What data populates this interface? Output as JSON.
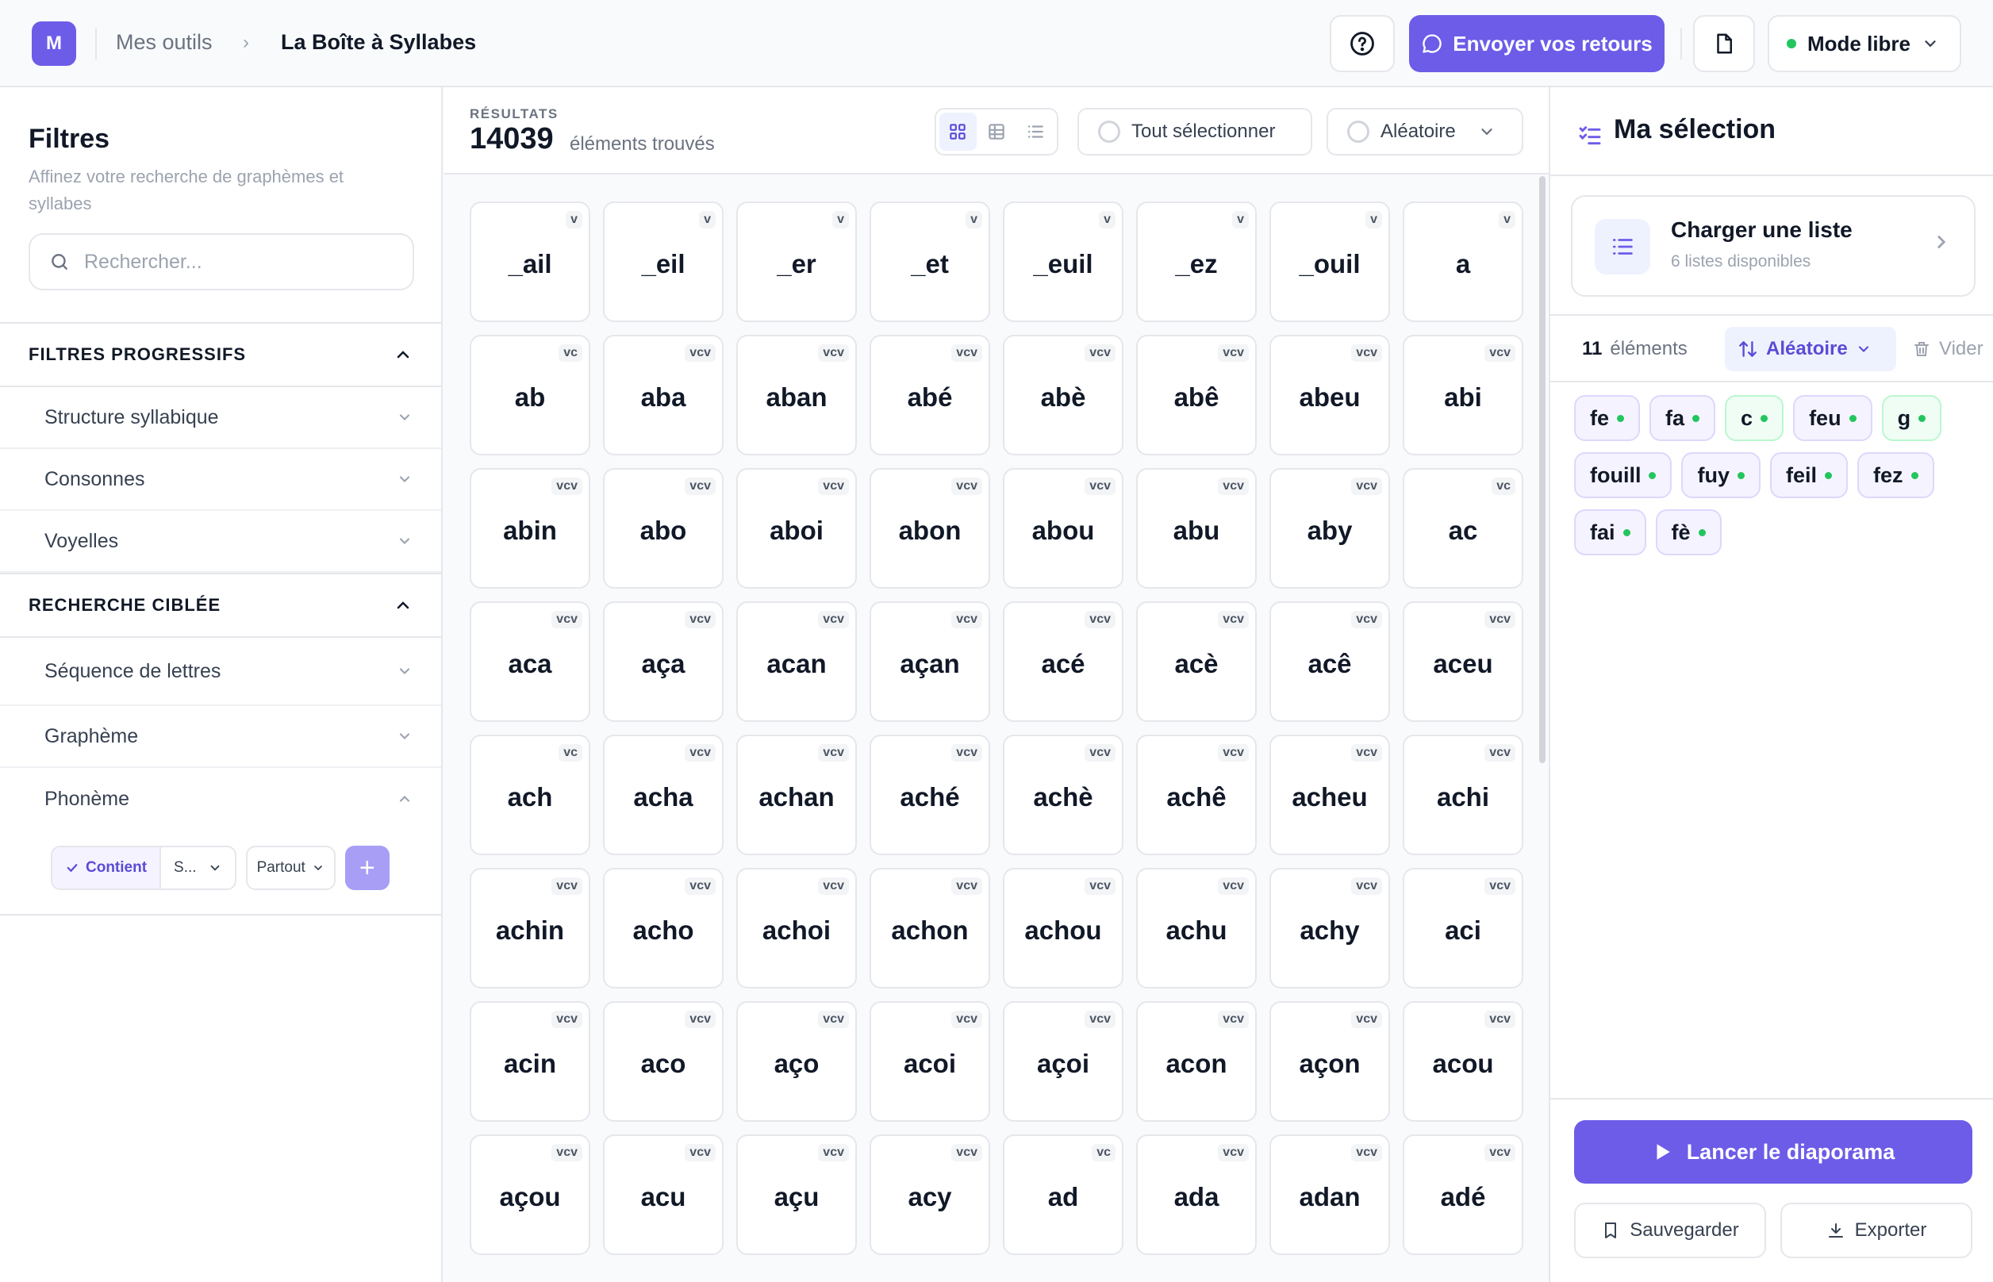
{
  "header": {
    "logo": "M",
    "breadcrumb_parent": "Mes outils",
    "breadcrumb_current": "La Boîte à Syllabes",
    "feedback_label": "Envoyer vos retours",
    "mode_label": "Mode libre"
  },
  "filters": {
    "title": "Filtres",
    "subtitle": "Affinez votre recherche de graphèmes et syllabes",
    "search_placeholder": "Rechercher...",
    "sections": [
      {
        "label": "FILTRES PROGRESSIFS",
        "expanded": true,
        "items": [
          {
            "label": "Structure syllabique"
          },
          {
            "label": "Consonnes"
          },
          {
            "label": "Voyelles"
          }
        ]
      },
      {
        "label": "RECHERCHE CIBLÉE",
        "expanded": true,
        "items": [
          {
            "label": "Séquence de lettres"
          },
          {
            "label": "Graphème"
          },
          {
            "label": "Phonème"
          }
        ]
      }
    ],
    "phoneme": {
      "mode": "Contient",
      "value": "S...",
      "position": "Partout",
      "add": "+"
    }
  },
  "results": {
    "label": "RÉSULTATS",
    "count": "14039",
    "text": "éléments trouvés",
    "select_all": "Tout sélectionner",
    "order": "Aléatoire",
    "items": [
      {
        "w": "_ail",
        "t": "v"
      },
      {
        "w": "_eil",
        "t": "v"
      },
      {
        "w": "_er",
        "t": "v"
      },
      {
        "w": "_et",
        "t": "v"
      },
      {
        "w": "_euil",
        "t": "v"
      },
      {
        "w": "_ez",
        "t": "v"
      },
      {
        "w": "_ouil",
        "t": "v"
      },
      {
        "w": "a",
        "t": "v"
      },
      {
        "w": "ab",
        "t": "vc"
      },
      {
        "w": "aba",
        "t": "vcv"
      },
      {
        "w": "aban",
        "t": "vcv"
      },
      {
        "w": "abé",
        "t": "vcv"
      },
      {
        "w": "abè",
        "t": "vcv"
      },
      {
        "w": "abê",
        "t": "vcv"
      },
      {
        "w": "abeu",
        "t": "vcv"
      },
      {
        "w": "abi",
        "t": "vcv"
      },
      {
        "w": "abin",
        "t": "vcv"
      },
      {
        "w": "abo",
        "t": "vcv"
      },
      {
        "w": "aboi",
        "t": "vcv"
      },
      {
        "w": "abon",
        "t": "vcv"
      },
      {
        "w": "abou",
        "t": "vcv"
      },
      {
        "w": "abu",
        "t": "vcv"
      },
      {
        "w": "aby",
        "t": "vcv"
      },
      {
        "w": "ac",
        "t": "vc"
      },
      {
        "w": "aca",
        "t": "vcv"
      },
      {
        "w": "aça",
        "t": "vcv"
      },
      {
        "w": "acan",
        "t": "vcv"
      },
      {
        "w": "açan",
        "t": "vcv"
      },
      {
        "w": "acé",
        "t": "vcv"
      },
      {
        "w": "acè",
        "t": "vcv"
      },
      {
        "w": "acê",
        "t": "vcv"
      },
      {
        "w": "aceu",
        "t": "vcv"
      },
      {
        "w": "ach",
        "t": "vc"
      },
      {
        "w": "acha",
        "t": "vcv"
      },
      {
        "w": "achan",
        "t": "vcv"
      },
      {
        "w": "aché",
        "t": "vcv"
      },
      {
        "w": "achè",
        "t": "vcv"
      },
      {
        "w": "achê",
        "t": "vcv"
      },
      {
        "w": "acheu",
        "t": "vcv"
      },
      {
        "w": "achi",
        "t": "vcv"
      },
      {
        "w": "achin",
        "t": "vcv"
      },
      {
        "w": "acho",
        "t": "vcv"
      },
      {
        "w": "achoi",
        "t": "vcv"
      },
      {
        "w": "achon",
        "t": "vcv"
      },
      {
        "w": "achou",
        "t": "vcv"
      },
      {
        "w": "achu",
        "t": "vcv"
      },
      {
        "w": "achy",
        "t": "vcv"
      },
      {
        "w": "aci",
        "t": "vcv"
      },
      {
        "w": "acin",
        "t": "vcv"
      },
      {
        "w": "aco",
        "t": "vcv"
      },
      {
        "w": "aço",
        "t": "vcv"
      },
      {
        "w": "acoi",
        "t": "vcv"
      },
      {
        "w": "açoi",
        "t": "vcv"
      },
      {
        "w": "acon",
        "t": "vcv"
      },
      {
        "w": "açon",
        "t": "vcv"
      },
      {
        "w": "acou",
        "t": "vcv"
      },
      {
        "w": "açou",
        "t": "vcv"
      },
      {
        "w": "acu",
        "t": "vcv"
      },
      {
        "w": "açu",
        "t": "vcv"
      },
      {
        "w": "acy",
        "t": "vcv"
      },
      {
        "w": "ad",
        "t": "vc"
      },
      {
        "w": "ada",
        "t": "vcv"
      },
      {
        "w": "adan",
        "t": "vcv"
      },
      {
        "w": "adé",
        "t": "vcv"
      }
    ]
  },
  "selection": {
    "title": "Ma sélection",
    "load_title": "Charger une liste",
    "load_sub": "6 listes disponibles",
    "count": "11",
    "count_label": "éléments",
    "order": "Aléatoire",
    "clear": "Vider",
    "chips": [
      {
        "w": "fe",
        "green": false
      },
      {
        "w": "fa",
        "green": false
      },
      {
        "w": "c",
        "green": true
      },
      {
        "w": "feu",
        "green": false
      },
      {
        "w": "g",
        "green": true
      },
      {
        "w": "fouill",
        "green": false
      },
      {
        "w": "fuy",
        "green": false
      },
      {
        "w": "feil",
        "green": false
      },
      {
        "w": "fez",
        "green": false
      },
      {
        "w": "fai",
        "green": false
      },
      {
        "w": "fè",
        "green": false
      }
    ],
    "play": "Lancer le diaporama",
    "save": "Sauvegarder",
    "export": "Exporter"
  },
  "colors": {
    "accent": "#6d5ce8",
    "status_green": "#22c55e"
  }
}
